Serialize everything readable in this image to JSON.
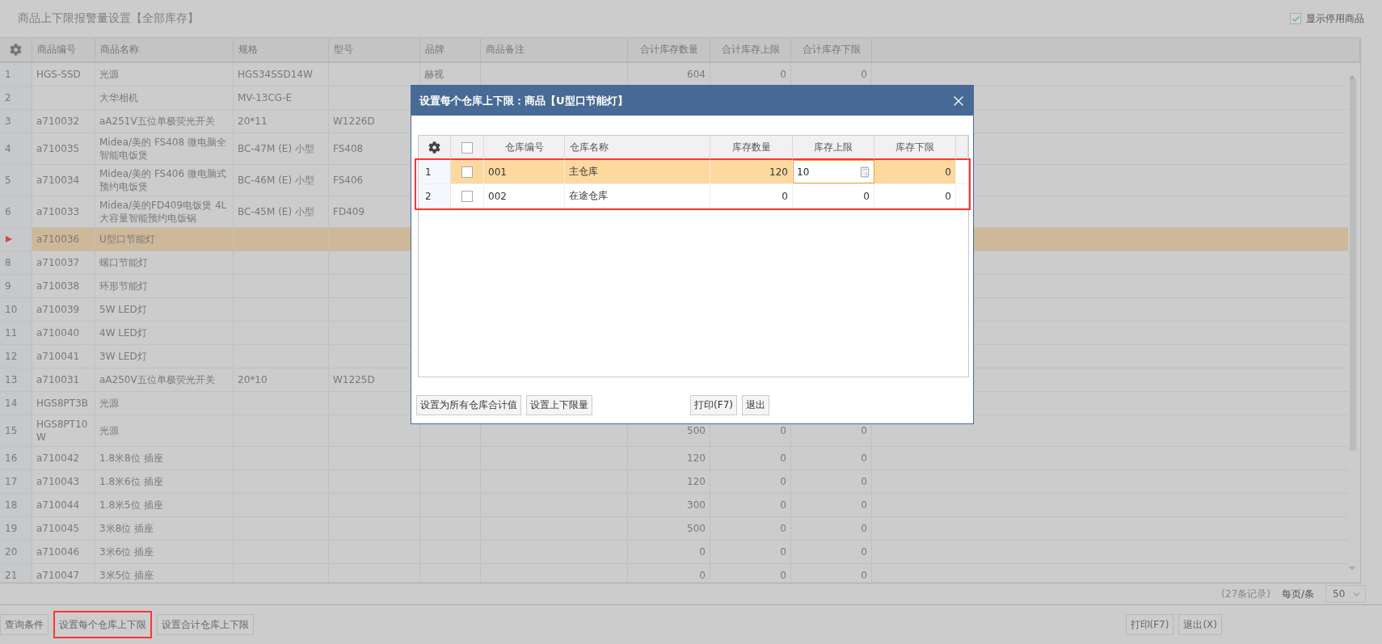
{
  "page": {
    "title": "商品上下限报警量设置【全部库存】",
    "show_disabled": {
      "label": "显示停用商品",
      "checked": true
    }
  },
  "table": {
    "columns": [
      "商品编号",
      "商品名称",
      "规格",
      "型号",
      "品牌",
      "商品备注",
      "合计库存数量",
      "合计库存上限",
      "合计库存下限"
    ],
    "rows": [
      {
        "index": "1",
        "selected": false,
        "cells": [
          "HGS-SSD",
          "光源",
          "HGS34SSD14W",
          null,
          "赫视",
          null,
          "604",
          "0",
          "0"
        ]
      },
      {
        "index": "2",
        "selected": false,
        "cells": [
          null,
          "大华相机",
          "MV-13CG-E",
          null,
          null,
          null,
          null,
          null,
          null
        ]
      },
      {
        "index": "3",
        "selected": false,
        "cells": [
          "a710032",
          "aA251V五位单极荧光开关",
          "20*11",
          "W1226D",
          null,
          null,
          null,
          null,
          null
        ]
      },
      {
        "index": "4",
        "selected": false,
        "cells": [
          "a710035",
          "Midea/美的 FS408 微电脑全智能电饭煲",
          "BC-47M (E) 小型",
          "FS408",
          null,
          null,
          null,
          null,
          null
        ]
      },
      {
        "index": "5",
        "selected": false,
        "cells": [
          "a710034",
          "Midea/美的 FS406 微电脑式预约电饭煲",
          "BC-46M (E) 小型",
          "FS406",
          null,
          null,
          null,
          null,
          null
        ]
      },
      {
        "index": "6",
        "selected": false,
        "cells": [
          "a710033",
          "Midea/美的FD409电饭煲 4L大容量智能预约电饭锅",
          "BC-45M (E) 小型",
          "FD409",
          null,
          null,
          null,
          null,
          null
        ]
      },
      {
        "selected": true,
        "cells": [
          "a710036",
          "U型口节能灯",
          null,
          null,
          null,
          null,
          null,
          null,
          null
        ]
      },
      {
        "index": "8",
        "selected": false,
        "cells": [
          "a710037",
          "螺口节能灯",
          null,
          null,
          null,
          null,
          null,
          null,
          null
        ]
      },
      {
        "index": "9",
        "selected": false,
        "cells": [
          "a710038",
          "环形节能灯",
          null,
          null,
          null,
          null,
          null,
          null,
          null
        ]
      },
      {
        "index": "10",
        "selected": false,
        "cells": [
          "a710039",
          "5W LED灯",
          null,
          null,
          null,
          null,
          null,
          null,
          null
        ]
      },
      {
        "index": "11",
        "selected": false,
        "cells": [
          "a710040",
          "4W LED灯",
          null,
          null,
          null,
          null,
          null,
          null,
          null
        ]
      },
      {
        "index": "12",
        "selected": false,
        "cells": [
          "a710041",
          "3W LED灯",
          null,
          null,
          null,
          null,
          null,
          null,
          null
        ]
      },
      {
        "index": "13",
        "selected": false,
        "cells": [
          "a710031",
          "aA250V五位单极荧光开关",
          "20*10",
          "W1225D",
          null,
          null,
          null,
          null,
          null
        ]
      },
      {
        "index": "14",
        "selected": false,
        "cells": [
          "HGS8PT3B",
          "光源",
          null,
          null,
          null,
          null,
          null,
          null,
          null
        ]
      },
      {
        "index": "15",
        "selected": false,
        "cells": [
          "HGS8PT10W",
          "光源",
          null,
          null,
          null,
          null,
          "500",
          "0",
          "0"
        ]
      },
      {
        "index": "16",
        "selected": false,
        "cells": [
          "a710042",
          "1.8米8位 插座",
          null,
          null,
          null,
          null,
          "120",
          "0",
          "0"
        ]
      },
      {
        "index": "17",
        "selected": false,
        "cells": [
          "a710043",
          "1.8米6位 插座",
          null,
          null,
          null,
          null,
          "120",
          "0",
          "0"
        ]
      },
      {
        "index": "18",
        "selected": false,
        "cells": [
          "a710044",
          "1.8米5位 插座",
          null,
          null,
          null,
          null,
          "300",
          "0",
          "0"
        ]
      },
      {
        "index": "19",
        "selected": false,
        "cells": [
          "a710045",
          "3米8位 插座",
          null,
          null,
          null,
          null,
          "500",
          "0",
          "0"
        ]
      },
      {
        "index": "20",
        "selected": false,
        "cells": [
          "a710046",
          "3米6位 插座",
          null,
          null,
          null,
          null,
          "0",
          "0",
          "0"
        ]
      },
      {
        "index": "21",
        "selected": false,
        "cells": [
          "a710047",
          "3米5位 插座",
          null,
          null,
          null,
          null,
          "0",
          "0",
          "0"
        ]
      }
    ]
  },
  "pager": {
    "record_count": "(27条记录)",
    "page_size_label": "每页/条",
    "page_size": "50"
  },
  "toolbar": {
    "left_buttons": [
      {
        "label": "查询条件",
        "highlighted": false
      },
      {
        "label": "设置每个仓库上下限",
        "highlighted": true
      },
      {
        "label": "设置合计仓库上下限",
        "highlighted": false
      }
    ],
    "right_buttons": [
      {
        "label": "打印(F7)",
        "highlighted": false
      },
      {
        "label": "退出(X)",
        "highlighted": false
      }
    ]
  },
  "dialog": {
    "title": "设置每个仓库上下限：商品【U型口节能灯】",
    "all_checked": false,
    "rows_highlighted": true,
    "columns": [
      "仓库编号",
      "仓库名称",
      "库存数量",
      "库存上限",
      "库存下限"
    ],
    "rows": [
      {
        "index": "1",
        "selected": true,
        "checked": false,
        "cells": [
          "001",
          "主仓库",
          "120",
          "10",
          "0"
        ]
      },
      {
        "index": "2",
        "selected": false,
        "checked": false,
        "cells": [
          "002",
          "在途仓库",
          "0",
          "0",
          "0"
        ]
      }
    ],
    "left_buttons": [
      "设置为所有仓库合计值",
      "设置上下限量"
    ],
    "right_buttons": [
      "打印(F7)",
      "退出"
    ]
  }
}
